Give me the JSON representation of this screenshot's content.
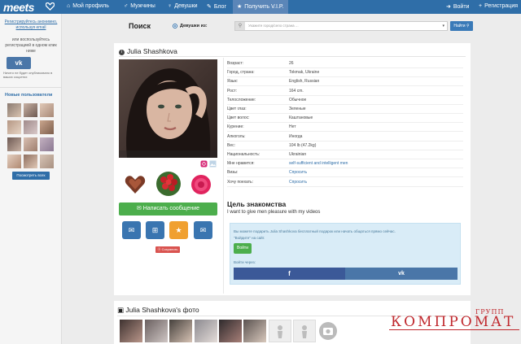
{
  "nav": {
    "logo": "meets",
    "items": [
      {
        "icon": "home-icon",
        "glyph": "⌂",
        "label": "Мой профиль"
      },
      {
        "icon": "male-icon",
        "glyph": "♂",
        "label": "Мужчины"
      },
      {
        "icon": "female-icon",
        "glyph": "♀",
        "label": "Девушки"
      },
      {
        "icon": "blog-icon",
        "glyph": "✎",
        "label": "Блог"
      },
      {
        "icon": "gift-icon",
        "glyph": "★",
        "label": "Получить V.I.P."
      }
    ],
    "login": "Войти",
    "register": "Регистрация"
  },
  "sidebar": {
    "register_link": "Регистрируйтесь анонимно, используя email",
    "or_text": "или воспользуйтесь регистрацией в одном клик ниже",
    "vk_label": "vk",
    "notice": "Ничего не будет опубликовано в ваших соцсетях",
    "new_users_title": "Новые пользователи",
    "show_all": "Посмотреть всех"
  },
  "search": {
    "title": "Поиск",
    "radio_label": "Девушки из:",
    "placeholder": "Укажите город/село страна ...",
    "button": "Найти"
  },
  "profile": {
    "name": "Julia Shashkova",
    "message_button": "Написать сообщение",
    "save_button": "Сохранить",
    "fields": [
      {
        "key": "Возраст:",
        "value": "26",
        "link": false
      },
      {
        "key": "Город, страна:",
        "value": "Tokmak, Ukraine",
        "link": false
      },
      {
        "key": "Язык:",
        "value": "English, Russian",
        "link": false
      },
      {
        "key": "Рост:",
        "value": "164 cm.",
        "link": false
      },
      {
        "key": "Телосложение:",
        "value": "Обычное",
        "link": false
      },
      {
        "key": "Цвет глаз:",
        "value": "Зеленые",
        "link": false
      },
      {
        "key": "Цвет волос:",
        "value": "Каштановые",
        "link": false
      },
      {
        "key": "Курение:",
        "value": "Нет",
        "link": false
      },
      {
        "key": "Алкоголь:",
        "value": "Иногда",
        "link": false
      },
      {
        "key": "Вес:",
        "value": "104 lb (47.2kg)",
        "link": false
      },
      {
        "key": "Национальность:",
        "value": "Ukrainian",
        "link": false
      },
      {
        "key": "Мне нравится:",
        "value": "self-sufficient and intelligent men",
        "link": true
      },
      {
        "key": "Визы:",
        "value": "Спросить",
        "link": true
      },
      {
        "key": "Хочу поехать:",
        "value": "Спросить",
        "link": true
      }
    ],
    "goal_title": "Цель знакомства",
    "goal_text": "I want to give men pleasure with my videos",
    "gift_text": "Вы можете подарить Julia Shashkova бесплатный подарок или начать общаться прямо сейчас.",
    "enter_hint": "\"Войдите\" на сайт.",
    "enter_button": "Войти",
    "login_via": "Войти через:",
    "fb_label": "f",
    "vk_label": "vk"
  },
  "photos": {
    "title": "Julia Shashkova's фото"
  },
  "watermark": {
    "small": "ГРУПП",
    "big": "КОМПРОМАТ"
  }
}
